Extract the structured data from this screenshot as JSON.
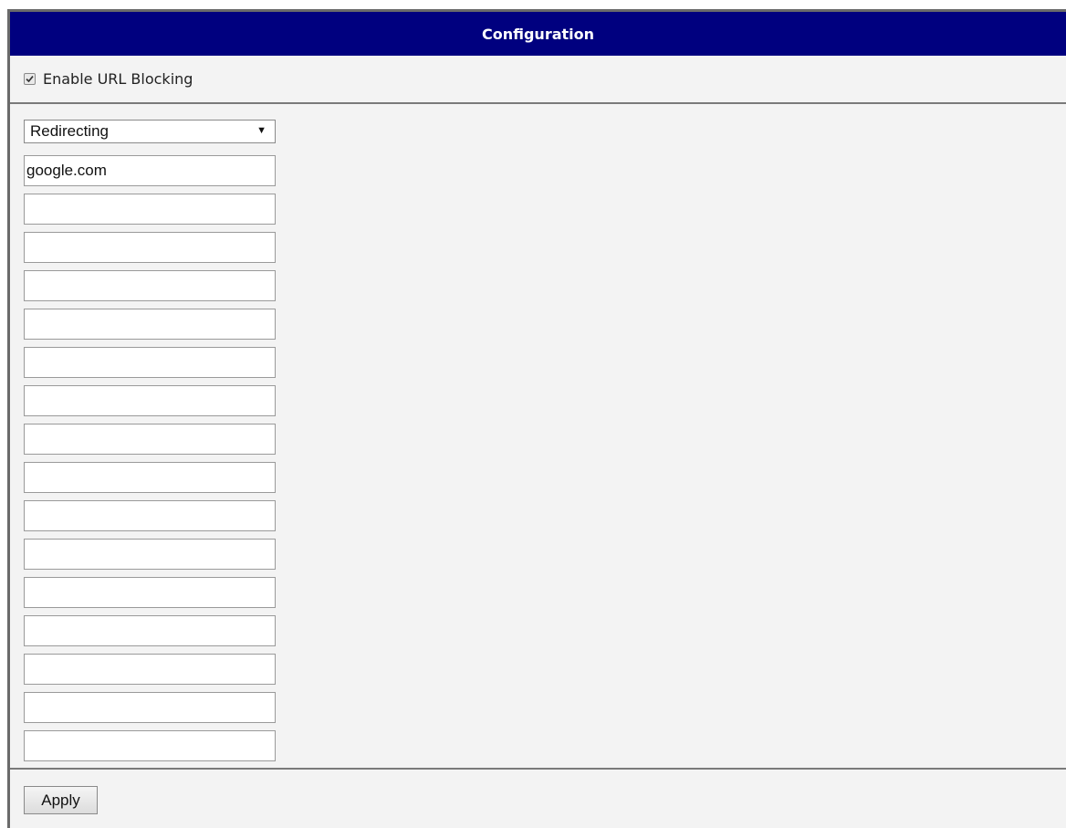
{
  "header": {
    "title": "Configuration"
  },
  "settings": {
    "enable_label": "Enable URL Blocking",
    "enable_checked": true
  },
  "mode": {
    "selected": "Redirecting"
  },
  "urls": {
    "entries": [
      "google.com",
      "",
      "",
      "",
      "",
      "",
      "",
      "",
      "",
      "",
      "",
      "",
      "",
      "",
      "",
      ""
    ]
  },
  "footer": {
    "apply_label": "Apply"
  },
  "icons": {
    "checkbox": "checkmark-icon",
    "dropdown": "dropdown-arrow-icon"
  }
}
